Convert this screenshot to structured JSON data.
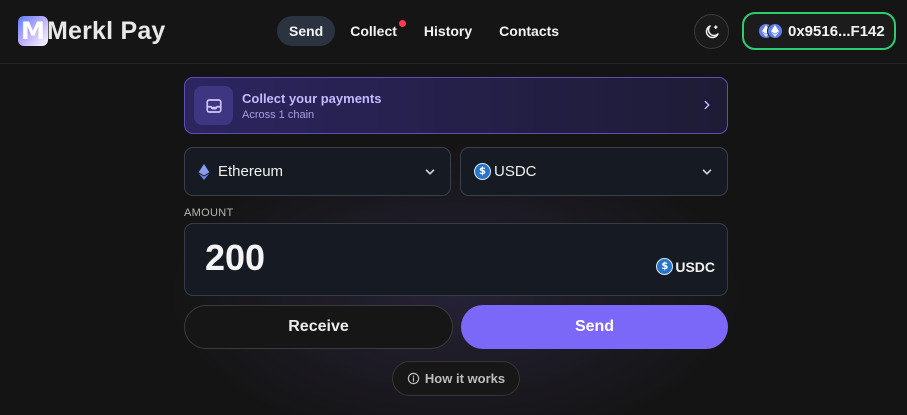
{
  "app": {
    "name": "Merkl Pay",
    "logo_letter": "M"
  },
  "nav": {
    "items": [
      {
        "label": "Send",
        "active": true
      },
      {
        "label": "Collect",
        "has_notification": true
      },
      {
        "label": "History"
      },
      {
        "label": "Contacts"
      }
    ]
  },
  "header": {
    "theme_icon": "moon-icon",
    "wallet": {
      "address": "0x9516...F142",
      "icon": "ethereum-icon"
    }
  },
  "banner": {
    "title": "Collect your payments",
    "subtitle": "Across 1 chain",
    "icon": "inbox-icon"
  },
  "form": {
    "chain": {
      "selected": "Ethereum",
      "icon": "ethereum-icon"
    },
    "token": {
      "selected": "USDC",
      "icon": "usdc-icon"
    },
    "amount": {
      "label": "AMOUNT",
      "value": "200",
      "token": "USDC"
    }
  },
  "actions": {
    "receive_label": "Receive",
    "send_label": "Send"
  },
  "help": {
    "label": "How it works",
    "icon": "info-icon"
  },
  "colors": {
    "accent": "#7c68f8",
    "wallet_border": "#2ecc71",
    "notification": "#ff3b4e",
    "banner_border": "#5d4fb5",
    "background": "#141414"
  }
}
